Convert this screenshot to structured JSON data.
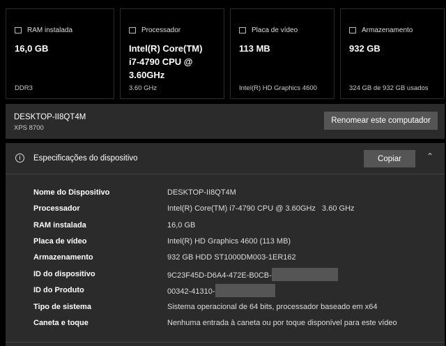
{
  "cards": [
    {
      "title": "RAM instalada",
      "value": "16,0 GB",
      "sub": "DDR3",
      "icon": "ram-icon"
    },
    {
      "title": "Processador",
      "value": "Intel(R) Core(TM) i7-4790 CPU @ 3.60GHz",
      "sub": "3.60 GHz",
      "icon": "processor-icon"
    },
    {
      "title": "Placa de vídeo",
      "value": "113 MB",
      "sub": "Intel(R) HD Graphics 4600",
      "icon": "gpu-icon"
    },
    {
      "title": "Armazenamento",
      "value": "932 GB",
      "sub": "324 GB de 932 GB usados",
      "icon": "storage-icon"
    }
  ],
  "device": {
    "name": "DESKTOP-II8QT4M",
    "model": "XPS 8700",
    "rename_label": "Renomear este computador"
  },
  "specs": {
    "title": "Especificações do dispositivo",
    "copy_label": "Copiar",
    "rows": [
      {
        "label": "Nome do Dispositivo",
        "value": "DESKTOP-II8QT4M"
      },
      {
        "label": "Processador",
        "value": "Intel(R) Core(TM) i7-4790 CPU @ 3.60GHz   3.60 GHz"
      },
      {
        "label": "RAM instalada",
        "value": "16,0 GB"
      },
      {
        "label": "Placa de vídeo",
        "value": "Intel(R) HD Graphics 4600 (113 MB)"
      },
      {
        "label": "Armazenamento",
        "value": "932 GB HDD ST1000DM003-1ER162"
      },
      {
        "label": "ID do dispositivo",
        "value": "9C23F45D-D6A4-472E-B0CB-"
      },
      {
        "label": "ID do Produto",
        "value": "00342-41310-"
      },
      {
        "label": "Tipo de sistema",
        "value": "Sistema operacional de 64 bits, processador baseado em x64"
      },
      {
        "label": "Caneta e toque",
        "value": "Nenhuma entrada à caneta ou por toque disponível para este vídeo"
      }
    ]
  }
}
